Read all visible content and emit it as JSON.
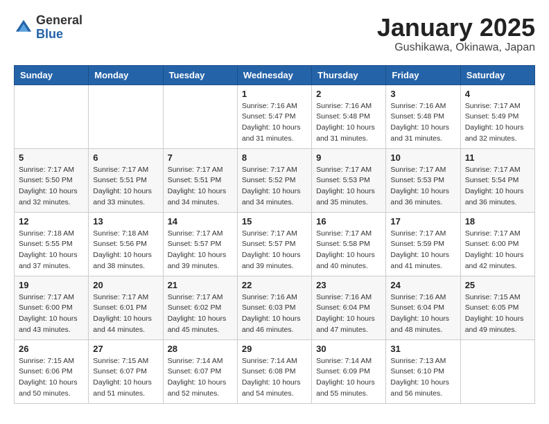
{
  "header": {
    "logo_general": "General",
    "logo_blue": "Blue",
    "month_title": "January 2025",
    "location": "Gushikawa, Okinawa, Japan"
  },
  "weekdays": [
    "Sunday",
    "Monday",
    "Tuesday",
    "Wednesday",
    "Thursday",
    "Friday",
    "Saturday"
  ],
  "weeks": [
    [
      {
        "day": "",
        "info": ""
      },
      {
        "day": "",
        "info": ""
      },
      {
        "day": "",
        "info": ""
      },
      {
        "day": "1",
        "info": "Sunrise: 7:16 AM\nSunset: 5:47 PM\nDaylight: 10 hours\nand 31 minutes."
      },
      {
        "day": "2",
        "info": "Sunrise: 7:16 AM\nSunset: 5:48 PM\nDaylight: 10 hours\nand 31 minutes."
      },
      {
        "day": "3",
        "info": "Sunrise: 7:16 AM\nSunset: 5:48 PM\nDaylight: 10 hours\nand 31 minutes."
      },
      {
        "day": "4",
        "info": "Sunrise: 7:17 AM\nSunset: 5:49 PM\nDaylight: 10 hours\nand 32 minutes."
      }
    ],
    [
      {
        "day": "5",
        "info": "Sunrise: 7:17 AM\nSunset: 5:50 PM\nDaylight: 10 hours\nand 32 minutes."
      },
      {
        "day": "6",
        "info": "Sunrise: 7:17 AM\nSunset: 5:51 PM\nDaylight: 10 hours\nand 33 minutes."
      },
      {
        "day": "7",
        "info": "Sunrise: 7:17 AM\nSunset: 5:51 PM\nDaylight: 10 hours\nand 34 minutes."
      },
      {
        "day": "8",
        "info": "Sunrise: 7:17 AM\nSunset: 5:52 PM\nDaylight: 10 hours\nand 34 minutes."
      },
      {
        "day": "9",
        "info": "Sunrise: 7:17 AM\nSunset: 5:53 PM\nDaylight: 10 hours\nand 35 minutes."
      },
      {
        "day": "10",
        "info": "Sunrise: 7:17 AM\nSunset: 5:53 PM\nDaylight: 10 hours\nand 36 minutes."
      },
      {
        "day": "11",
        "info": "Sunrise: 7:17 AM\nSunset: 5:54 PM\nDaylight: 10 hours\nand 36 minutes."
      }
    ],
    [
      {
        "day": "12",
        "info": "Sunrise: 7:18 AM\nSunset: 5:55 PM\nDaylight: 10 hours\nand 37 minutes."
      },
      {
        "day": "13",
        "info": "Sunrise: 7:18 AM\nSunset: 5:56 PM\nDaylight: 10 hours\nand 38 minutes."
      },
      {
        "day": "14",
        "info": "Sunrise: 7:17 AM\nSunset: 5:57 PM\nDaylight: 10 hours\nand 39 minutes."
      },
      {
        "day": "15",
        "info": "Sunrise: 7:17 AM\nSunset: 5:57 PM\nDaylight: 10 hours\nand 39 minutes."
      },
      {
        "day": "16",
        "info": "Sunrise: 7:17 AM\nSunset: 5:58 PM\nDaylight: 10 hours\nand 40 minutes."
      },
      {
        "day": "17",
        "info": "Sunrise: 7:17 AM\nSunset: 5:59 PM\nDaylight: 10 hours\nand 41 minutes."
      },
      {
        "day": "18",
        "info": "Sunrise: 7:17 AM\nSunset: 6:00 PM\nDaylight: 10 hours\nand 42 minutes."
      }
    ],
    [
      {
        "day": "19",
        "info": "Sunrise: 7:17 AM\nSunset: 6:00 PM\nDaylight: 10 hours\nand 43 minutes."
      },
      {
        "day": "20",
        "info": "Sunrise: 7:17 AM\nSunset: 6:01 PM\nDaylight: 10 hours\nand 44 minutes."
      },
      {
        "day": "21",
        "info": "Sunrise: 7:17 AM\nSunset: 6:02 PM\nDaylight: 10 hours\nand 45 minutes."
      },
      {
        "day": "22",
        "info": "Sunrise: 7:16 AM\nSunset: 6:03 PM\nDaylight: 10 hours\nand 46 minutes."
      },
      {
        "day": "23",
        "info": "Sunrise: 7:16 AM\nSunset: 6:04 PM\nDaylight: 10 hours\nand 47 minutes."
      },
      {
        "day": "24",
        "info": "Sunrise: 7:16 AM\nSunset: 6:04 PM\nDaylight: 10 hours\nand 48 minutes."
      },
      {
        "day": "25",
        "info": "Sunrise: 7:15 AM\nSunset: 6:05 PM\nDaylight: 10 hours\nand 49 minutes."
      }
    ],
    [
      {
        "day": "26",
        "info": "Sunrise: 7:15 AM\nSunset: 6:06 PM\nDaylight: 10 hours\nand 50 minutes."
      },
      {
        "day": "27",
        "info": "Sunrise: 7:15 AM\nSunset: 6:07 PM\nDaylight: 10 hours\nand 51 minutes."
      },
      {
        "day": "28",
        "info": "Sunrise: 7:14 AM\nSunset: 6:07 PM\nDaylight: 10 hours\nand 52 minutes."
      },
      {
        "day": "29",
        "info": "Sunrise: 7:14 AM\nSunset: 6:08 PM\nDaylight: 10 hours\nand 54 minutes."
      },
      {
        "day": "30",
        "info": "Sunrise: 7:14 AM\nSunset: 6:09 PM\nDaylight: 10 hours\nand 55 minutes."
      },
      {
        "day": "31",
        "info": "Sunrise: 7:13 AM\nSunset: 6:10 PM\nDaylight: 10 hours\nand 56 minutes."
      },
      {
        "day": "",
        "info": ""
      }
    ]
  ]
}
